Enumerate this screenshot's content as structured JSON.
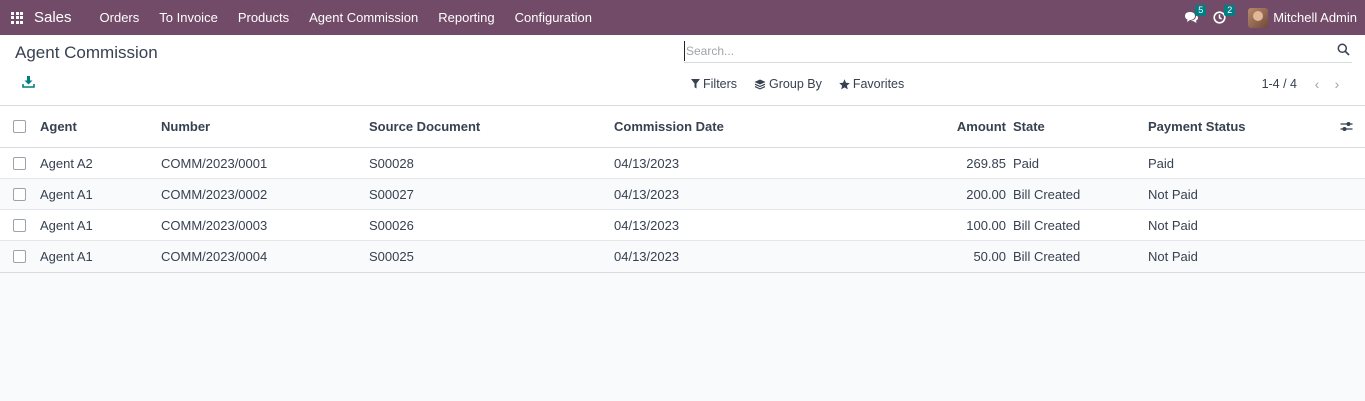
{
  "navbar": {
    "app_name": "Sales",
    "menu": [
      "Orders",
      "To Invoice",
      "Products",
      "Agent Commission",
      "Reporting",
      "Configuration"
    ],
    "messages_count": "5",
    "activities_count": "2",
    "user_name": "Mitchell Admin",
    "background_color": "#714b67",
    "badge_color": "#017e84"
  },
  "control_panel": {
    "title": "Agent Commission",
    "search_placeholder": "Search...",
    "filters_label": "Filters",
    "group_by_label": "Group By",
    "favorites_label": "Favorites",
    "pager_value": "1-4 / 4"
  },
  "table": {
    "headers": {
      "agent": "Agent",
      "number": "Number",
      "source": "Source Document",
      "date": "Commission Date",
      "amount": "Amount",
      "state": "State",
      "payment": "Payment Status"
    },
    "rows": [
      {
        "agent": "Agent A2",
        "number": "COMM/2023/0001",
        "source": "S00028",
        "date": "04/13/2023",
        "amount": "269.85",
        "state": "Paid",
        "payment": "Paid"
      },
      {
        "agent": "Agent A1",
        "number": "COMM/2023/0002",
        "source": "S00027",
        "date": "04/13/2023",
        "amount": "200.00",
        "state": "Bill Created",
        "payment": "Not Paid"
      },
      {
        "agent": "Agent A1",
        "number": "COMM/2023/0003",
        "source": "S00026",
        "date": "04/13/2023",
        "amount": "100.00",
        "state": "Bill Created",
        "payment": "Not Paid"
      },
      {
        "agent": "Agent A1",
        "number": "COMM/2023/0004",
        "source": "S00025",
        "date": "04/13/2023",
        "amount": "50.00",
        "state": "Bill Created",
        "payment": "Not Paid"
      }
    ]
  }
}
